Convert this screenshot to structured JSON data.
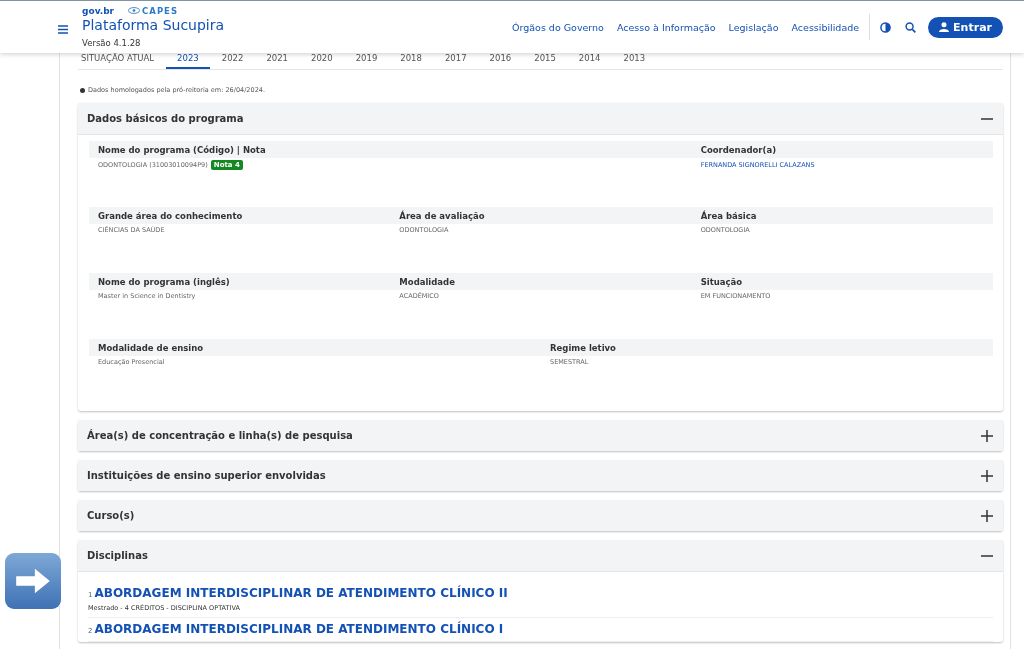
{
  "header": {
    "gov_logo": "gov.br",
    "capes_logo": "CAPES",
    "title": "Plataforma Sucupira",
    "version": "Versão 4.1.28",
    "links": [
      "Órgãos do Governo",
      "Acesso à Informação",
      "Legislação",
      "Acessibilidade"
    ],
    "login_button": "Entrar"
  },
  "year_tabs": [
    {
      "label": "SITUAÇÃO ATUAL",
      "selected": false
    },
    {
      "label": "2023",
      "selected": true
    },
    {
      "label": "2022",
      "selected": false
    },
    {
      "label": "2021",
      "selected": false
    },
    {
      "label": "2020",
      "selected": false
    },
    {
      "label": "2019",
      "selected": false
    },
    {
      "label": "2018",
      "selected": false
    },
    {
      "label": "2017",
      "selected": false
    },
    {
      "label": "2016",
      "selected": false
    },
    {
      "label": "2015",
      "selected": false
    },
    {
      "label": "2014",
      "selected": false
    },
    {
      "label": "2013",
      "selected": false
    }
  ],
  "note": "Dados homologados pela pró-reitoria em: 26/04/2024.",
  "sections": [
    {
      "kind": "fields",
      "title": "Dados básicos do programa",
      "expanded": true,
      "groups": [
        {
          "fields": [
            {
              "label": "Nome do programa (Código) | Nota",
              "value": "ODONTOLOGIA (31003010094P9)",
              "badge": "Nota 4"
            },
            {
              "label": "Coordenador(a)",
              "value": "FERNANDA SIGNORELLI CALAZANS",
              "link": true
            }
          ]
        },
        {
          "fields": [
            {
              "label": "Grande área do conhecimento",
              "value": "CIÊNCIAS DA SAÚDE"
            },
            {
              "label": "Área de avaliação",
              "value": "ODONTOLOGIA"
            },
            {
              "label": "Área básica",
              "value": "ODONTOLOGIA"
            }
          ]
        },
        {
          "fields": [
            {
              "label": "Nome do programa (inglês)",
              "value": "Master in Science in Dentistry"
            },
            {
              "label": "Modalidade",
              "value": "ACADÊMICO"
            },
            {
              "label": "Situação",
              "value": "EM FUNCIONAMENTO"
            }
          ]
        },
        {
          "fields": [
            {
              "label": "Modalidade de ensino",
              "value": "Educação Presencial"
            },
            {
              "label": "Regime letivo",
              "value": "SEMESTRAL"
            }
          ]
        }
      ]
    },
    {
      "kind": "plain",
      "title": "Área(s) de concentração e linha(s) de pesquisa",
      "expanded": false
    },
    {
      "kind": "plain",
      "title": "Instituições de ensino superior envolvidas",
      "expanded": false
    },
    {
      "kind": "plain",
      "title": "Curso(s)",
      "expanded": false
    },
    {
      "kind": "list",
      "title": "Disciplinas",
      "expanded": true,
      "items": [
        {
          "number": "1",
          "title": "ABORDAGEM INTERDISCIPLINAR DE ATENDIMENTO CLÍNICO II",
          "details": "Mestrado - 4 CRÉDITOS - DISCIPLINA OPTATIVA"
        },
        {
          "number": "2",
          "title": "ABORDAGEM INTERDISCIPLINAR DE ATENDIMENTO CLÍNICO I"
        }
      ]
    }
  ]
}
